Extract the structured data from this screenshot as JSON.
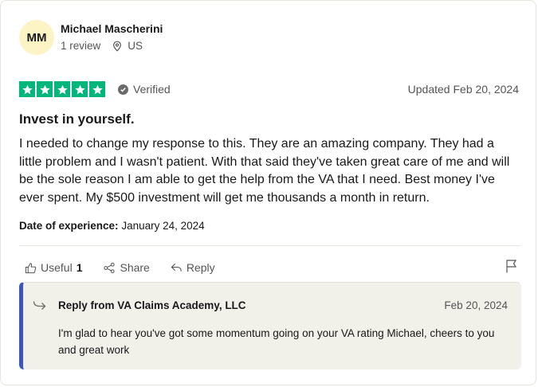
{
  "reviewer": {
    "initials": "MM",
    "name": "Michael Mascherini",
    "review_count": "1 review",
    "country": "US"
  },
  "review": {
    "rating": 5,
    "verified_label": "Verified",
    "updated": "Updated Feb 20, 2024",
    "title": "Invest in yourself.",
    "body": "I needed to change my response to this. They are an amazing company. They had a little problem and I wasn't patient. With that said they've taken great care of me and will be the sole reason I am able to get the help from the VA that I need. Best money I've ever spent. My $500 investment will get me thousands a month in return.",
    "experience_label": "Date of experience:",
    "experience_date": "January 24, 2024"
  },
  "actions": {
    "useful_label": "Useful",
    "useful_count": "1",
    "share_label": "Share",
    "reply_label": "Reply"
  },
  "reply": {
    "from": "Reply from VA Claims Academy, LLC",
    "date": "Feb 20, 2024",
    "text": "I'm glad to hear you've got some momentum going on your VA rating Michael, cheers to you and great work"
  },
  "colors": {
    "star_green": "#00b67a",
    "reply_accent": "#3c57bc",
    "reply_bg": "#f1f0e9",
    "avatar_bg": "#fdf4c6"
  },
  "icons": [
    "location-pin-icon",
    "star-icon",
    "check-circle-icon",
    "thumbs-up-icon",
    "share-icon",
    "reply-icon",
    "flag-icon",
    "reply-arrow-icon"
  ]
}
